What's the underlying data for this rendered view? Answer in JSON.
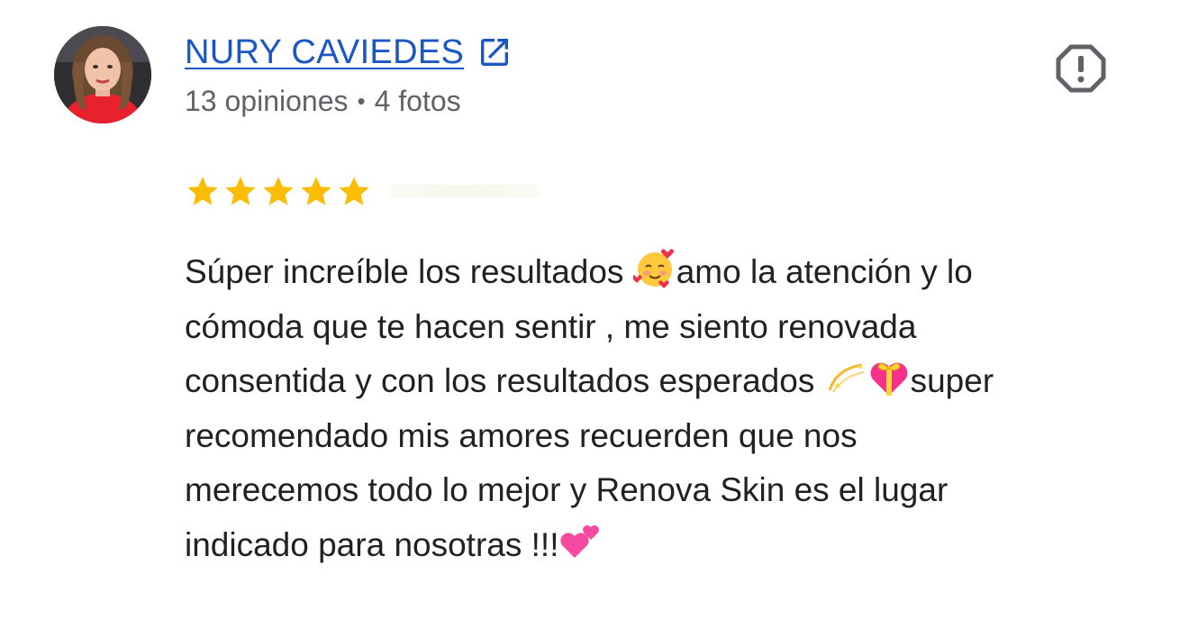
{
  "reviewer": {
    "name": "NURY CAVIEDES",
    "reviews_count": "13 opiniones",
    "separator": "•",
    "photos_count": "4 fotos"
  },
  "rating": {
    "stars": 5,
    "max": 5
  },
  "review": {
    "line1_a": "Súper increíble los resultados ",
    "line1_b": "amo la atención y lo",
    "line2": "cómoda que te hacen sentir , me siento renovada",
    "line3_a": "consentida y con los resultados esperados ",
    "line3_b": "super",
    "line4": "recomendado mis amores recuerden que nos",
    "line5": "merecemos todo lo mejor y Renova Skin es el lugar",
    "line6": "indicado para nosotras !!!"
  },
  "icons": {
    "external": "external-link-icon",
    "report": "report-icon",
    "star": "star-icon",
    "emojis": [
      "smiling-face-with-hearts",
      "dizzy",
      "heart-with-ribbon",
      "two-hearts"
    ]
  },
  "colors": {
    "link": "#1a56c4",
    "meta": "#5f6368",
    "text": "#202124",
    "star": "#fbbc04",
    "report": "#5f6368"
  }
}
